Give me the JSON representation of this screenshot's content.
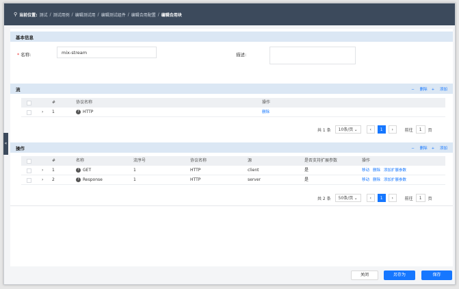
{
  "breadcrumb": {
    "label": "当前位置:",
    "items": [
      "测试",
      "测试用例",
      "编辑测试用",
      "编辑测试组件",
      "编辑合用配置"
    ],
    "current": "编辑合用块"
  },
  "basic": {
    "title": "基本信息",
    "name_label": "名称:",
    "name_value": "mix-stream",
    "desc_label": "描述:",
    "desc_value": ""
  },
  "flow": {
    "title": "流",
    "delete_label": "删除",
    "add_label": "添加",
    "columns": [
      "#",
      "协议名称",
      "操作"
    ],
    "rows": [
      {
        "index": "1",
        "protocol": "HTTP",
        "action": "删除"
      }
    ],
    "pager": {
      "total": "共 1 条",
      "page_size": "10条/页",
      "current": "1",
      "goto_label": "前往",
      "goto_value": "1",
      "goto_suffix": "页"
    }
  },
  "ops": {
    "title": "操作",
    "delete_label": "删除",
    "add_label": "添加",
    "columns": [
      "#",
      "名称",
      "流序号",
      "协议名称",
      "源",
      "是否支持扩展参数",
      "操作"
    ],
    "rows": [
      {
        "index": "1",
        "name": "GET",
        "flow_no": "1",
        "protocol": "HTTP",
        "source": "client",
        "ext": "是",
        "move": "移动",
        "delete": "删除",
        "add_ext": "添加扩展参数"
      },
      {
        "index": "2",
        "name": "Response",
        "flow_no": "1",
        "protocol": "HTTP",
        "source": "server",
        "ext": "是",
        "move": "移动",
        "delete": "删除",
        "add_ext": "添加扩展参数"
      }
    ],
    "pager": {
      "total": "共 2 条",
      "page_size": "50条/页",
      "current": "1",
      "goto_label": "前往",
      "goto_value": "1",
      "goto_suffix": "页"
    }
  },
  "footer": {
    "close_label": "关闭",
    "save_as_label": "另存为",
    "save_label": "保存"
  },
  "side_toggle": "«"
}
